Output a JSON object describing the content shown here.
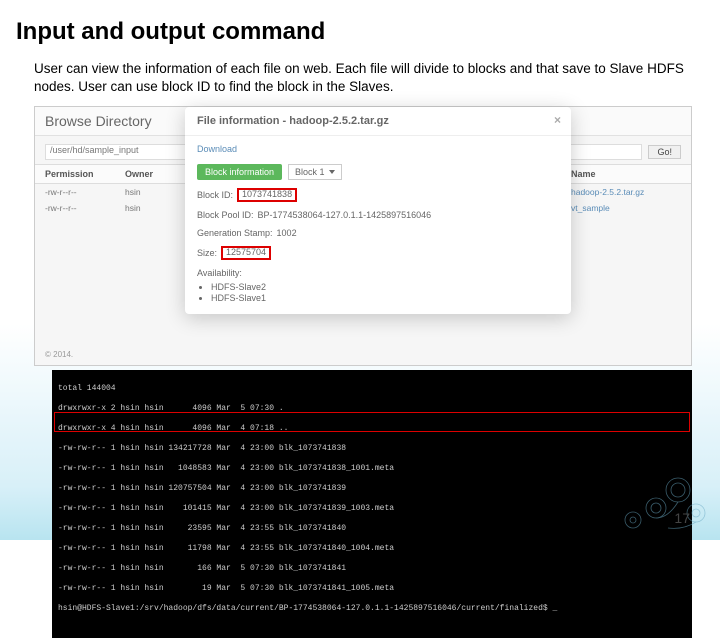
{
  "title": "Input and output command",
  "body_text": "User can view the information of each file on web. Each file will divide to blocks and that save to Slave HDFS nodes. User can use block ID to find the block in the Slaves.",
  "page_number": "17",
  "browser": {
    "title": "Browse Directory",
    "path": "/user/hd/sample_input",
    "go_label": "Go!",
    "columns": {
      "permission": "Permission",
      "owner": "Owner",
      "name": "Name"
    },
    "rows": [
      {
        "perm": "-rw-r--r--",
        "owner": "hsin",
        "name": "hadoop-2.5.2.tar.gz"
      },
      {
        "perm": "-rw-r--r--",
        "owner": "hsin",
        "name": "vt_sample"
      }
    ],
    "copyright": "© 2014."
  },
  "modal": {
    "title": "File information - hadoop-2.5.2.tar.gz",
    "download": "Download",
    "block_info_label": "Block information",
    "block_select": "Block 1",
    "block_id_label": "Block ID:",
    "block_id_value": "1073741838",
    "block_pool_label": "Block Pool ID:",
    "block_pool_value": "BP-1774538064-127.0.1.1-1425897516046",
    "gen_stamp_label": "Generation Stamp:",
    "gen_stamp_value": "1002",
    "size_label": "Size:",
    "size_value": "12575704",
    "availability_label": "Availability:",
    "availability": [
      "HDFS-Slave2",
      "HDFS-Slave1"
    ]
  },
  "terminal": {
    "lines": [
      "total 144004",
      "drwxrwxr-x 2 hsin hsin      4096 Mar  5 07:30 .",
      "drwxrwxr-x 4 hsin hsin      4096 Mar  4 07:18 ..",
      "-rw-rw-r-- 1 hsin hsin 134217728 Mar  4 23:00 blk_1073741838",
      "-rw-rw-r-- 1 hsin hsin   1048583 Mar  4 23:00 blk_1073741838_1001.meta",
      "-rw-rw-r-- 1 hsin hsin 120757504 Mar  4 23:00 blk_1073741839",
      "-rw-rw-r-- 1 hsin hsin    101415 Mar  4 23:00 blk_1073741839_1003.meta",
      "-rw-rw-r-- 1 hsin hsin     23595 Mar  4 23:55 blk_1073741840",
      "-rw-rw-r-- 1 hsin hsin     11798 Mar  4 23:55 blk_1073741840_1004.meta",
      "-rw-rw-r-- 1 hsin hsin       166 Mar  5 07:30 blk_1073741841",
      "-rw-rw-r-- 1 hsin hsin        19 Mar  5 07:30 blk_1073741841_1005.meta",
      "hsin@HDFS-Slave1:/srv/hadoop/dfs/data/current/BP-1774538064-127.0.1.1-1425897516046/current/finalized$ _"
    ]
  }
}
